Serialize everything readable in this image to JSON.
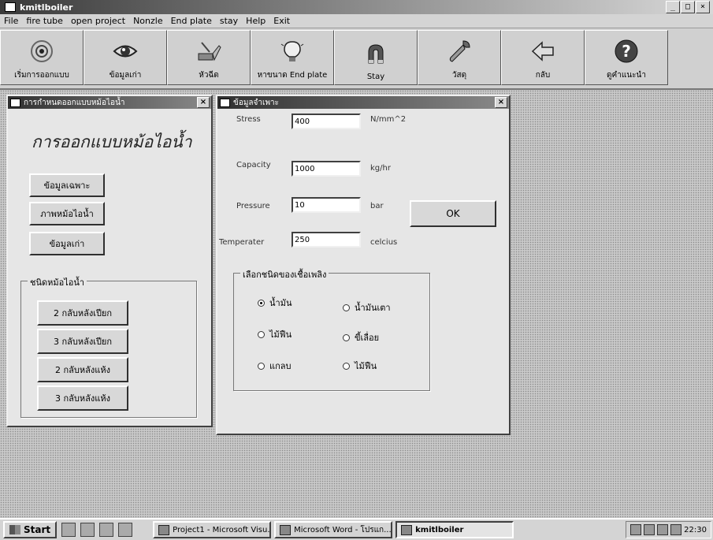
{
  "window": {
    "title": "kmitlboiler",
    "controls": [
      "_",
      "□",
      "×"
    ]
  },
  "menu": [
    "File",
    "fire tube",
    "open project",
    "Nonzle",
    "End plate",
    "stay",
    "Help",
    "Exit"
  ],
  "toolbar": [
    {
      "label": "เริ่มการออกแบบ",
      "icon": "target-icon"
    },
    {
      "label": "ข้อมูลเก่า",
      "icon": "eye-icon"
    },
    {
      "label": "หัวฉีด",
      "icon": "nozzle-icon"
    },
    {
      "label": "หาขนาด End plate",
      "icon": "lightbulb-icon"
    },
    {
      "label": "Stay",
      "icon": "magnet-icon"
    },
    {
      "label": "วัสดุ",
      "icon": "wrench-icon"
    },
    {
      "label": "กลับ",
      "icon": "back-arrow-icon"
    },
    {
      "label": "ดูคำแนะนำ",
      "icon": "help-icon"
    }
  ],
  "design_window": {
    "title": "การกำหนดออกแบบหม้อไอน้ำ",
    "heading": "การออกแบบหม้อไอน้ำ",
    "buttons": [
      "ข้อมูลเฉพาะ",
      "ภาพหม้อไอน้ำ",
      "ข้อมูลเก่า"
    ],
    "boiler_type_group": {
      "label": "ชนิดหม้อไอน้ำ",
      "options": [
        "2 กลับหลังเปียก",
        "3 กลับหลังเปียก",
        "2 กลับหลังแห้ง",
        "3 กลับหลังแห้ง"
      ]
    }
  },
  "spec_window": {
    "title": "ข้อมูลจำเพาะ",
    "fields": [
      {
        "label": "Stress",
        "value": "400",
        "unit": "N/mm^2"
      },
      {
        "label": "Capacity",
        "value": "1000",
        "unit": "kg/hr"
      },
      {
        "label": "Pressure",
        "value": "10",
        "unit": "bar"
      },
      {
        "label": "Temperater",
        "value": "250",
        "unit": "celcius"
      }
    ],
    "ok_label": "OK",
    "fuel_group": {
      "label": "เลือกชนิดของเชื้อเพลิง",
      "options": [
        "น้ำมัน",
        "น้ำมันเตา",
        "ไม้ฟืน",
        "ขี้เลื่อย",
        "แกลบ",
        "ไม้ฟืน"
      ],
      "selected": "น้ำมัน"
    }
  },
  "taskbar": {
    "start_label": "Start",
    "tasks": [
      "Project1 - Microsoft Visu...",
      "Microsoft Word - โปรแก...",
      "kmitlboiler"
    ],
    "active_task": "kmitlboiler",
    "clock": "22:30"
  }
}
